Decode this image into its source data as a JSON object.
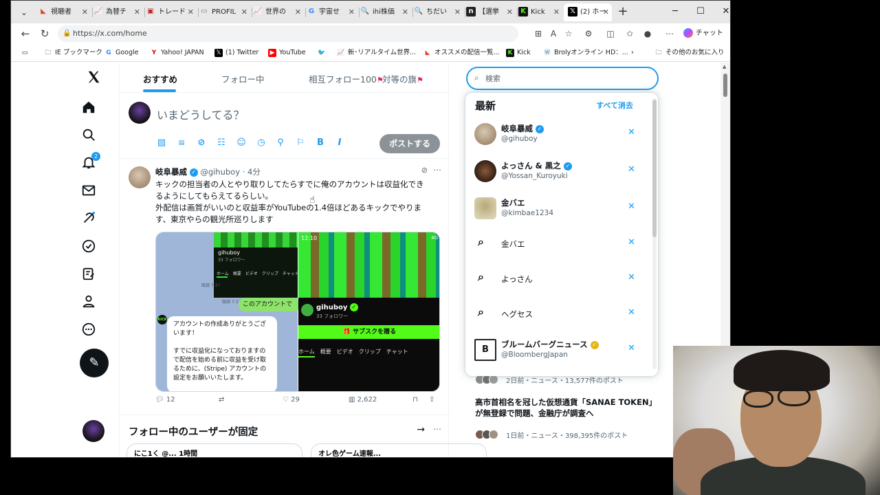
{
  "browser": {
    "tabs": [
      {
        "label": "視聴者",
        "color": "#e0452b"
      },
      {
        "label": "為替チ",
        "color": "#d83030"
      },
      {
        "label": "トレード",
        "color": "#c02020"
      },
      {
        "label": "PROFIL",
        "color": "#777777"
      },
      {
        "label": "世界の",
        "color": "#d83030"
      },
      {
        "label": "宇宙せ",
        "color": "#4285f4"
      },
      {
        "label": "ihi株価",
        "color": "#1a73e8"
      },
      {
        "label": "ちだい",
        "color": "#1a73e8"
      },
      {
        "label": "【選挙",
        "color": "#222222"
      },
      {
        "label": "Kick",
        "color": "#53fc18"
      },
      {
        "label": "(2) ホー",
        "color": "#000000"
      }
    ],
    "url": "https://x.com/home",
    "chat_label": "チャット",
    "bookmarks": [
      {
        "label": "IE ブックマーク"
      },
      {
        "label": "Google"
      },
      {
        "label": "Yahoo! JAPAN"
      },
      {
        "label": "(1) Twitter"
      },
      {
        "label": "YouTube"
      },
      {
        "label": ""
      },
      {
        "label": "新･リアルタイム世界..."
      },
      {
        "label": "オススメの配信一覧..."
      },
      {
        "label": "Kick"
      },
      {
        "label": "Brolyオンライン HD：..."
      },
      {
        "label": "その他のお気に入り"
      }
    ]
  },
  "nav": {
    "notif_count": "2"
  },
  "timeline": {
    "tabs": [
      "おすすめ",
      "フォロー中",
      "相互フォロー100",
      "対等の旗"
    ],
    "compose_placeholder": "いまどうしてる？",
    "post_button": "ポストする"
  },
  "tweet": {
    "name": "岐阜暴威",
    "handle": "@gihuboy",
    "time": "4分",
    "text_line1": "キックの担当者の人とやり取りしてたらすでに俺のアカウントは収益化でき",
    "text_line2": "るようにしてもらえてるらしい。",
    "text_line3": "外配信は画質がいいのと収益率がYouTubeの1.4倍ほどあるキックでやりま",
    "text_line4": "す、東京やらの観光所巡りします",
    "media": {
      "left_time": "",
      "left_channel": "gihuboy",
      "left_followers": "33 フォロワー",
      "left_tabs": "ホーム　概要　ビデオ　クリップ　チャット",
      "green_bubble": "このアカウントで",
      "white_bubble": "アカウントの作成ありがとうございます！\n\nすでに収益化になっておりますので配信を始める前に収益を受け取るために、(Stripe) アカウントの設定をお願いいたします。",
      "kick_label": "KICK",
      "ts1": "既読 7:37",
      "ts2": "既読 7:37",
      "right_time": "12:10",
      "right_status": "4G",
      "right_channel": "gihuboy",
      "right_followers": "33 フォロワー",
      "sub_button": "サブスクを贈る",
      "right_tabs": "ホーム　概要　ビデオ　クリップ　チャット"
    },
    "replies": "12",
    "likes": "29",
    "views": "2,622"
  },
  "pinned": {
    "title": "フォロー中のユーザーが固定",
    "card1": "にこ1く @...  1時間",
    "card2": "オレ色ゲーム速報..."
  },
  "search": {
    "placeholder": "検索",
    "header": "最新",
    "clear_all": "すべて消去",
    "items": [
      {
        "type": "user",
        "name": "岐阜暴威",
        "handle": "@gihuboy",
        "verified": "blue"
      },
      {
        "type": "user",
        "name": "よっさん & 黒之",
        "handle": "@Yossan_Kuroyuki",
        "verified": "blue"
      },
      {
        "type": "user",
        "name": "金バエ",
        "handle": "@kimbae1234",
        "verified": ""
      },
      {
        "type": "query",
        "text": "金バエ"
      },
      {
        "type": "query",
        "text": "よっさん"
      },
      {
        "type": "query",
        "text": "ヘグセス"
      },
      {
        "type": "user",
        "name": "ブルームバーグニュース",
        "handle": "@BloombergJapan",
        "verified": "gold"
      }
    ]
  },
  "trends": {
    "t1_meta": "2日前・ニュース・13,577件のポスト",
    "t2_title": "高市首相名を冠した仮想通貨「SANAE TOKEN」が無登録で問題、金融庁が調査へ",
    "t2_meta": "1日前・ニュース・398,395件のポスト"
  }
}
